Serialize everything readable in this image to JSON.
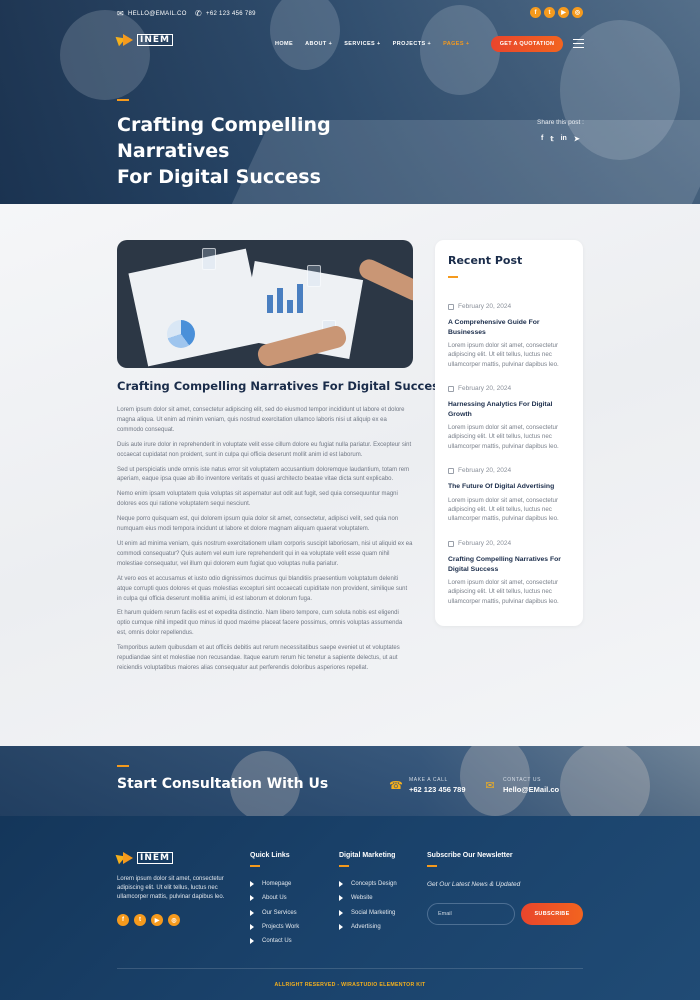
{
  "topbar": {
    "email": "HELLO@EMAIL.CO",
    "phone": "+62 123 456 789",
    "social_icons": [
      "facebook-icon",
      "twitter-icon",
      "youtube-icon",
      "dribbble-icon"
    ]
  },
  "nav": {
    "logo_text": "INEM",
    "items": [
      {
        "label": "HOME"
      },
      {
        "label": "ABOUT +"
      },
      {
        "label": "SERVICES +"
      },
      {
        "label": "PROJECTS +"
      },
      {
        "label": "PAGES +"
      }
    ],
    "active_item": "PAGES +",
    "cta_label": "GET A QUOTATION"
  },
  "hero": {
    "title_line1": "Crafting Compelling Narratives",
    "title_line2": "For Digital Success",
    "share_label": "Share this post :",
    "share_icons": [
      "f",
      "t",
      "in",
      "tg"
    ]
  },
  "article": {
    "title": "Crafting Compelling Narratives For Digital Success",
    "paragraphs": [
      "Lorem ipsum dolor sit amet, consectetur adipiscing elit, sed do eiusmod tempor incididunt ut labore et dolore magna aliqua. Ut enim ad minim veniam, quis nostrud exercitation ullamco laboris nisi ut aliquip ex ea commodo consequat.",
      "Duis aute irure dolor in reprehenderit in voluptate velit esse cillum dolore eu fugiat nulla pariatur. Excepteur sint occaecat cupidatat non proident, sunt in culpa qui officia deserunt mollit anim id est laborum.",
      "Sed ut perspiciatis unde omnis iste natus error sit voluptatem accusantium doloremque laudantium, totam rem aperiam, eaque ipsa quae ab illo inventore veritatis et quasi architecto beatae vitae dicta sunt explicabo.",
      "Nemo enim ipsam voluptatem quia voluptas sit aspernatur aut odit aut fugit, sed quia consequuntur magni dolores eos qui ratione voluptatem sequi nesciunt.",
      "Neque porro quisquam est, qui dolorem ipsum quia dolor sit amet, consectetur, adipisci velit, sed quia non numquam eius modi tempora incidunt ut labore et dolore magnam aliquam quaerat voluptatem.",
      "Ut enim ad minima veniam, quis nostrum exercitationem ullam corporis suscipit laboriosam, nisi ut aliquid ex ea commodi consequatur? Quis autem vel eum iure reprehenderit qui in ea voluptate velit esse quam nihil molestiae consequatur, vel illum qui dolorem eum fugiat quo voluptas nulla pariatur.",
      "At vero eos et accusamus et iusto odio dignissimos ducimus qui blanditiis praesentium voluptatum deleniti atque corrupti quos dolores et quas molestias excepturi sint occaecati cupiditate non provident, similique sunt in culpa qui officia deserunt mollitia animi, id est laborum et dolorum fuga.",
      "Et harum quidem rerum facilis est et expedita distinctio. Nam libero tempore, cum soluta nobis est eligendi optio cumque nihil impedit quo minus id quod maxime placeat facere possimus, omnis voluptas assumenda est, omnis dolor repellendus.",
      "Temporibus autem quibusdam et aut officiis debitis aut rerum necessitatibus saepe eveniet ut et voluptates repudiandae sint et molestiae non recusandae. Itaque earum rerum hic tenetur a sapiente delectus, ut aut reiciendis voluptatibus maiores alias consequatur aut perferendis doloribus asperiores repellat."
    ]
  },
  "sidebar": {
    "title": "Recent Post",
    "posts": [
      {
        "date": "February 20, 2024",
        "title": "A Comprehensive Guide For Businesses",
        "excerpt": "Lorem ipsum dolor sit amet, consectetur adipiscing elit. Ut elit tellus, luctus nec ullamcorper mattis, pulvinar dapibus leo."
      },
      {
        "date": "February 20, 2024",
        "title": "Harnessing Analytics For Digital Growth",
        "excerpt": "Lorem ipsum dolor sit amet, consectetur adipiscing elit. Ut elit tellus, luctus nec ullamcorper mattis, pulvinar dapibus leo."
      },
      {
        "date": "February 20, 2024",
        "title": "The Future Of Digital Advertising",
        "excerpt": "Lorem ipsum dolor sit amet, consectetur adipiscing elit. Ut elit tellus, luctus nec ullamcorper mattis, pulvinar dapibus leo."
      },
      {
        "date": "February 20, 2024",
        "title": "Crafting Compelling Narratives For Digital Success",
        "excerpt": "Lorem ipsum dolor sit amet, consectetur adipiscing elit. Ut elit tellus, luctus nec ullamcorper mattis, pulvinar dapibus leo."
      }
    ]
  },
  "cta": {
    "title": "Start Consultation With Us",
    "call_label": "MAKE A CALL",
    "call_value": "+62 123 456 789",
    "contact_label": "CONTACT US",
    "contact_value": "Hello@EMail.co"
  },
  "footer": {
    "about": "Lorem ipsum dolor sit amet, consectetur adipiscing elit. Ut elit tellus, luctus nec ullamcorper mattis, pulvinar dapibus leo.",
    "quick_links_title": "Quick Links",
    "quick_links": [
      "Homepage",
      "About Us",
      "Our Services",
      "Projects Work",
      "Contact Us"
    ],
    "digital_title": "Digital Marketing",
    "digital_links": [
      "Concepts Design",
      "Website",
      "Social Marketing",
      "Advertising"
    ],
    "newsletter_title": "Subscribe Our Newsletter",
    "newsletter_subtitle": "Get Our Latest News & Updated",
    "email_placeholder": "Email",
    "subscribe_label": "SUBSCRIBE",
    "copyright": "ALLRIGHT RESERVED - WIRASTUDIO ELEMENTOR KIT"
  },
  "colors": {
    "accent": "#f59a1d",
    "cta_gradient_start": "#e9452c",
    "navy": "#1a2c4a",
    "footer_bg": "#14365a"
  }
}
